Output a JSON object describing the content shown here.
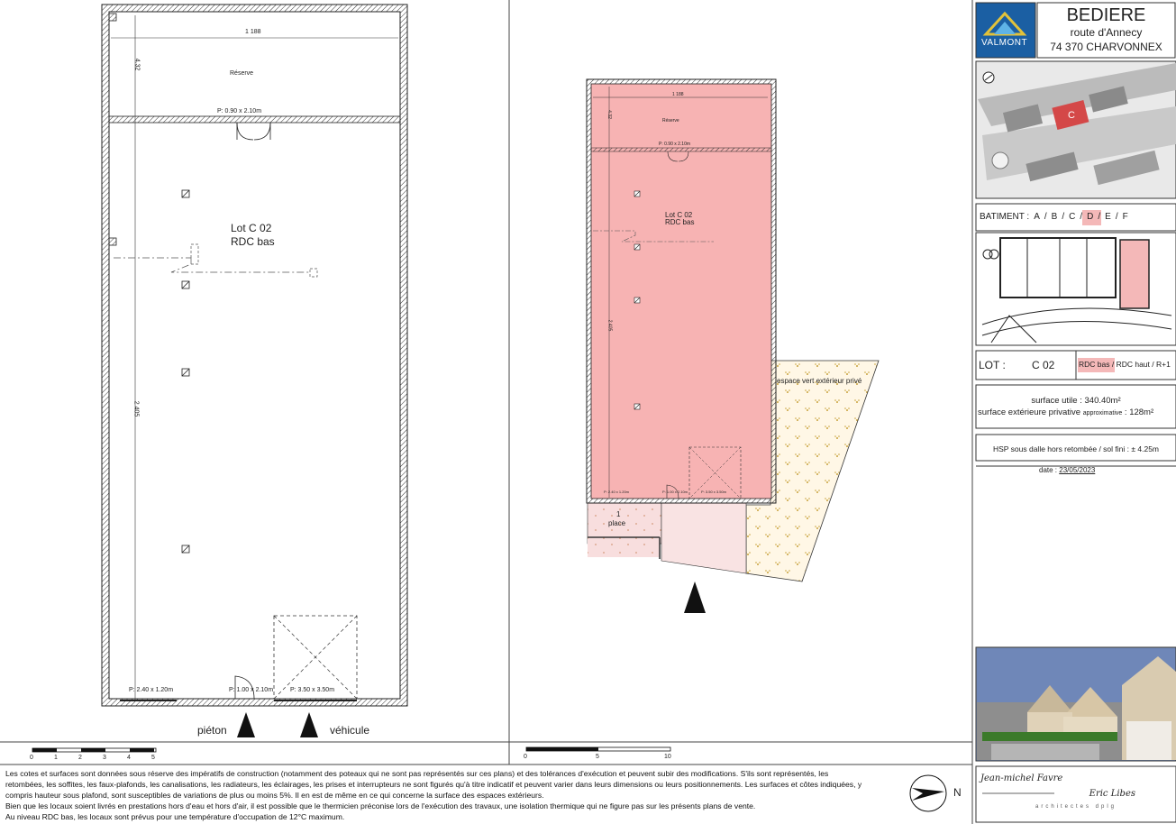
{
  "project": {
    "brand": "VALMONT",
    "name": "BEDIERE",
    "address_line1": "route d'Annecy",
    "address_line2": "74 370 CHARVONNEX"
  },
  "left_plan": {
    "total_width": "1 188",
    "reserve_depth": "4.32",
    "main_depth": "2 405",
    "reserve_label": "Réserve",
    "door_top": "P: 0.90 x 2.10m",
    "lot_label": "Lot C 02",
    "level_label": "RDC bas",
    "door_bottom_left": "P: 2.40 x 1.20m",
    "door_bottom_mid": "P: 1.00 x 2.10m",
    "door_bottom_right": "P: 3.50 x 3.50m",
    "access_pedestrian": "piéton",
    "access_vehicle": "véhicule",
    "scale_ticks": [
      "0",
      "1",
      "2",
      "3",
      "4",
      "5"
    ]
  },
  "right_plan": {
    "total_width": "1 188",
    "reserve_depth": "4.32",
    "main_depth": "2 405",
    "reserve_label": "Réserve",
    "door_top": "P: 0.90 x 2.10m",
    "lot_label": "Lot C 02",
    "level_label": "RDC bas",
    "door_bottom_left": "P: 2.40 x 1.20m",
    "door_bottom_mid": "P: 1.00 x 2.10m",
    "door_bottom_right": "P: 3.50 x 3.50m",
    "parking_number": "1",
    "parking_label": "place",
    "green_space": "espace vert extérieur privé",
    "scale_ticks": [
      "0",
      "5",
      "10"
    ]
  },
  "panel": {
    "batiment_label": "BATIMENT :",
    "buildings": [
      "A",
      "B",
      "C",
      "D",
      "E",
      "F"
    ],
    "selected_building": "C",
    "lot_key": "LOT :",
    "lot_value": "C 02",
    "level_selected": "RDC bas",
    "level_other": "RDC haut / R+1",
    "surface_utile": "surface utile : 340.40m²",
    "surface_ext_prefix": "surface extérieure privative",
    "surface_ext_approx": "approximative",
    "surface_ext_value": ": 128m²",
    "hsp": "HSP sous dalle hors retombée / sol fini : ± 4.25m",
    "date_label": "date :",
    "date_value": "23/05/2023",
    "aerial_marker": "C"
  },
  "architects": {
    "name1": "Jean-michel Favre",
    "name2": "Eric Libes",
    "subtitle": "architectes dplg"
  },
  "north": "N",
  "notes": [
    "Les cotes et surfaces sont données sous réserve des impératifs de construction (notamment des poteaux qui ne sont pas représentés sur ces plans) et des tolérances d'exécution et peuvent subir des modifications. S'ils sont représentés, les",
    "retombées, les soffites, les faux-plafonds, les canalisations, les radiateurs, les éclairages, les prises et interrupteurs ne sont figurés qu'à titre indicatif et peuvent varier dans leurs dimensions ou leurs positionnements. Les surfaces et côtes indiquées, y",
    "compris hauteur sous plafond, sont susceptibles de variations de plus ou moins 5%. Il en est de même en ce qui concerne la surface des espaces extérieurs.",
    "Bien que les locaux soient livrés en prestations hors d'eau et hors d'air, il est possible que le thermicien préconise lors de l'exécution des travaux, une isolation thermique qui ne figure pas sur les présents plans de vente.",
    "Au niveau RDC bas, les locaux sont prévus pour une température d'occupation de 12°C maximum."
  ],
  "colors": {
    "lot_fill": "#f7b3b3",
    "hatch_fill": "#fbeeee",
    "green_dots": "#c8a23a",
    "brand_blue": "#1b5fa3",
    "brand_yellow": "#e2c23a",
    "highlight": "#f4b8b8"
  }
}
